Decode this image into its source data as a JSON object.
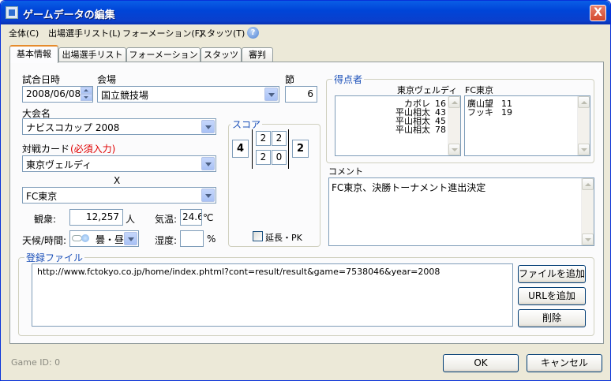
{
  "window": {
    "title": "ゲームデータの編集",
    "close": "X"
  },
  "menu": [
    "全体(C)",
    "出場選手リスト(L)",
    "フォーメーション(F)",
    "スタッツ(T)"
  ],
  "help": "?",
  "tabs": [
    "基本情報",
    "出場選手リスト",
    "フォーメーション",
    "スタッツ",
    "審判"
  ],
  "basic": {
    "date_label": "試合日時",
    "date_value": "2008/06/08",
    "venue_label": "会場",
    "venue_value": "国立競技場",
    "round_label": "節",
    "round_value": "6",
    "competition_label": "大会名",
    "competition_value": "ナビスコカップ 2008",
    "match_label": "対戦カード",
    "required_note": "(必須入力)",
    "home_team": "東京ヴェルディ",
    "vs": "X",
    "away_team": "FC東京",
    "attendance_label": "観衆:",
    "attendance_value": "12,257",
    "attendance_unit": "人",
    "temp_label": "気温:",
    "temp_value": "24.6",
    "temp_unit": "℃",
    "weather_label": "天候/時間:",
    "weather_value": "曇・昼",
    "humidity_label": "湿度:",
    "humidity_value": "",
    "humidity_unit": "%"
  },
  "score": {
    "title": "スコア",
    "home_total": "4",
    "away_total": "2",
    "home_half1": "2",
    "home_half2": "2",
    "away_half1": "2",
    "away_half2": "0",
    "extra_label": "延長・PK"
  },
  "scorers": {
    "title": "得点者",
    "home_team": "東京ヴェルディ",
    "away_team": "FC東京",
    "home": [
      {
        "name": "カボレ",
        "min": "16"
      },
      {
        "name": "平山相太",
        "min": "43"
      },
      {
        "name": "平山相太",
        "min": "45"
      },
      {
        "name": "平山相太",
        "min": "78"
      }
    ],
    "away": [
      {
        "name": "廣山望",
        "min": "11"
      },
      {
        "name": "フッキ",
        "min": "19"
      }
    ]
  },
  "comment": {
    "label": "コメント",
    "text": "FC東京、決勝トーナメント進出決定"
  },
  "files": {
    "title": "登録ファイル",
    "items": [
      "http://www.fctokyo.co.jp/home/index.phtml?cont=result/result&game=7538046&year=2008"
    ],
    "add_file": "ファイルを追加",
    "add_url": "URLを追加",
    "delete": "削除"
  },
  "footer": {
    "game_id": "Game ID: 0",
    "ok": "OK",
    "cancel": "キャンセル"
  }
}
